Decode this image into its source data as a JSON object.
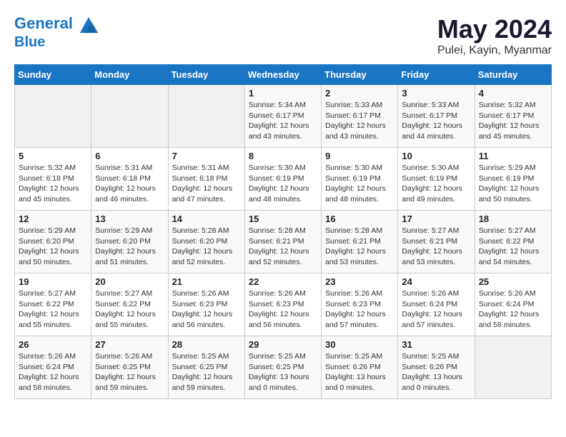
{
  "header": {
    "logo_line1": "General",
    "logo_line2": "Blue",
    "month_year": "May 2024",
    "location": "Pulei, Kayin, Myanmar"
  },
  "days_of_week": [
    "Sunday",
    "Monday",
    "Tuesday",
    "Wednesday",
    "Thursday",
    "Friday",
    "Saturday"
  ],
  "weeks": [
    [
      {
        "day": "",
        "info": ""
      },
      {
        "day": "",
        "info": ""
      },
      {
        "day": "",
        "info": ""
      },
      {
        "day": "1",
        "info": "Sunrise: 5:34 AM\nSunset: 6:17 PM\nDaylight: 12 hours\nand 43 minutes."
      },
      {
        "day": "2",
        "info": "Sunrise: 5:33 AM\nSunset: 6:17 PM\nDaylight: 12 hours\nand 43 minutes."
      },
      {
        "day": "3",
        "info": "Sunrise: 5:33 AM\nSunset: 6:17 PM\nDaylight: 12 hours\nand 44 minutes."
      },
      {
        "day": "4",
        "info": "Sunrise: 5:32 AM\nSunset: 6:17 PM\nDaylight: 12 hours\nand 45 minutes."
      }
    ],
    [
      {
        "day": "5",
        "info": "Sunrise: 5:32 AM\nSunset: 6:18 PM\nDaylight: 12 hours\nand 45 minutes."
      },
      {
        "day": "6",
        "info": "Sunrise: 5:31 AM\nSunset: 6:18 PM\nDaylight: 12 hours\nand 46 minutes."
      },
      {
        "day": "7",
        "info": "Sunrise: 5:31 AM\nSunset: 6:18 PM\nDaylight: 12 hours\nand 47 minutes."
      },
      {
        "day": "8",
        "info": "Sunrise: 5:30 AM\nSunset: 6:19 PM\nDaylight: 12 hours\nand 48 minutes."
      },
      {
        "day": "9",
        "info": "Sunrise: 5:30 AM\nSunset: 6:19 PM\nDaylight: 12 hours\nand 48 minutes."
      },
      {
        "day": "10",
        "info": "Sunrise: 5:30 AM\nSunset: 6:19 PM\nDaylight: 12 hours\nand 49 minutes."
      },
      {
        "day": "11",
        "info": "Sunrise: 5:29 AM\nSunset: 6:19 PM\nDaylight: 12 hours\nand 50 minutes."
      }
    ],
    [
      {
        "day": "12",
        "info": "Sunrise: 5:29 AM\nSunset: 6:20 PM\nDaylight: 12 hours\nand 50 minutes."
      },
      {
        "day": "13",
        "info": "Sunrise: 5:29 AM\nSunset: 6:20 PM\nDaylight: 12 hours\nand 51 minutes."
      },
      {
        "day": "14",
        "info": "Sunrise: 5:28 AM\nSunset: 6:20 PM\nDaylight: 12 hours\nand 52 minutes."
      },
      {
        "day": "15",
        "info": "Sunrise: 5:28 AM\nSunset: 6:21 PM\nDaylight: 12 hours\nand 52 minutes."
      },
      {
        "day": "16",
        "info": "Sunrise: 5:28 AM\nSunset: 6:21 PM\nDaylight: 12 hours\nand 53 minutes."
      },
      {
        "day": "17",
        "info": "Sunrise: 5:27 AM\nSunset: 6:21 PM\nDaylight: 12 hours\nand 53 minutes."
      },
      {
        "day": "18",
        "info": "Sunrise: 5:27 AM\nSunset: 6:22 PM\nDaylight: 12 hours\nand 54 minutes."
      }
    ],
    [
      {
        "day": "19",
        "info": "Sunrise: 5:27 AM\nSunset: 6:22 PM\nDaylight: 12 hours\nand 55 minutes."
      },
      {
        "day": "20",
        "info": "Sunrise: 5:27 AM\nSunset: 6:22 PM\nDaylight: 12 hours\nand 55 minutes."
      },
      {
        "day": "21",
        "info": "Sunrise: 5:26 AM\nSunset: 6:23 PM\nDaylight: 12 hours\nand 56 minutes."
      },
      {
        "day": "22",
        "info": "Sunrise: 5:26 AM\nSunset: 6:23 PM\nDaylight: 12 hours\nand 56 minutes."
      },
      {
        "day": "23",
        "info": "Sunrise: 5:26 AM\nSunset: 6:23 PM\nDaylight: 12 hours\nand 57 minutes."
      },
      {
        "day": "24",
        "info": "Sunrise: 5:26 AM\nSunset: 6:24 PM\nDaylight: 12 hours\nand 57 minutes."
      },
      {
        "day": "25",
        "info": "Sunrise: 5:26 AM\nSunset: 6:24 PM\nDaylight: 12 hours\nand 58 minutes."
      }
    ],
    [
      {
        "day": "26",
        "info": "Sunrise: 5:26 AM\nSunset: 6:24 PM\nDaylight: 12 hours\nand 58 minutes."
      },
      {
        "day": "27",
        "info": "Sunrise: 5:26 AM\nSunset: 6:25 PM\nDaylight: 12 hours\nand 59 minutes."
      },
      {
        "day": "28",
        "info": "Sunrise: 5:25 AM\nSunset: 6:25 PM\nDaylight: 12 hours\nand 59 minutes."
      },
      {
        "day": "29",
        "info": "Sunrise: 5:25 AM\nSunset: 6:25 PM\nDaylight: 13 hours\nand 0 minutes."
      },
      {
        "day": "30",
        "info": "Sunrise: 5:25 AM\nSunset: 6:26 PM\nDaylight: 13 hours\nand 0 minutes."
      },
      {
        "day": "31",
        "info": "Sunrise: 5:25 AM\nSunset: 6:26 PM\nDaylight: 13 hours\nand 0 minutes."
      },
      {
        "day": "",
        "info": ""
      }
    ]
  ]
}
